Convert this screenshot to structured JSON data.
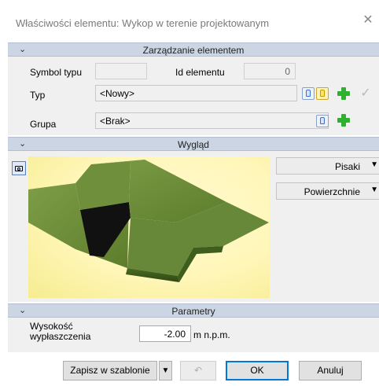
{
  "window": {
    "title": "Właściwości elementu: Wykop w terenie projektowanym",
    "close_glyph": "✕"
  },
  "sections": {
    "management": {
      "label": "Zarządzanie elementem"
    },
    "appearance": {
      "label": "Wygląd"
    },
    "parameters": {
      "label": "Parametry"
    }
  },
  "management": {
    "symbol_label": "Symbol typu",
    "symbol_value": "",
    "id_label": "Id elementu",
    "id_value": "0",
    "type_label": "Typ",
    "type_value": "<Nowy>",
    "group_label": "Grupa",
    "group_value": "<Brak>"
  },
  "appearance": {
    "pens_label": "Pisaki",
    "surfaces_label": "Powierzchnie"
  },
  "parameters": {
    "flatten_height_label": "Wysokość wypłaszczenia",
    "flatten_height_value": "-2.00",
    "flatten_height_unit": "m n.p.m."
  },
  "footer": {
    "save_template_label": "Zapisz w szablonie",
    "ok_label": "OK",
    "cancel_label": "Anuluj"
  },
  "colors": {
    "section_header": "#cbd5e3",
    "panel": "#f0f0f0",
    "preview_background": "#fff6b8",
    "terrain": "#6e8f3a",
    "accent_green": "#2fb12f",
    "ok_border": "#0078d7"
  }
}
